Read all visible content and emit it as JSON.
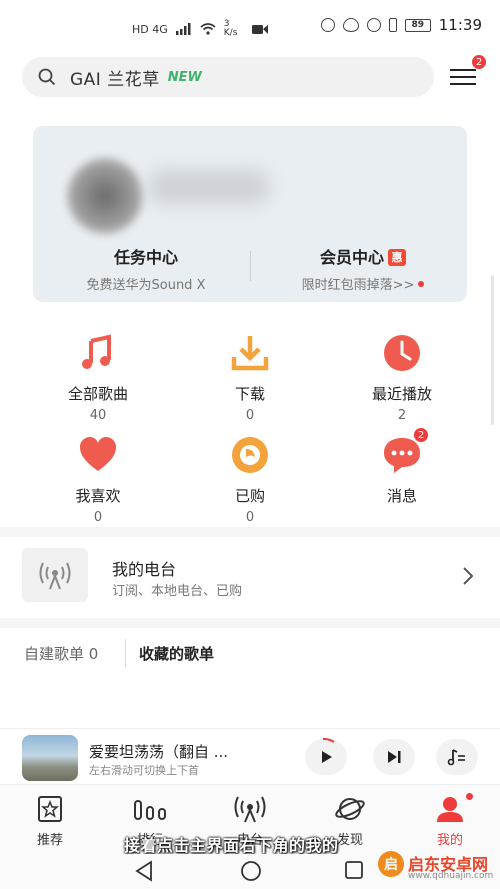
{
  "status_bar": {
    "left_text": "HD 4G",
    "net_speed": "3 K/s",
    "battery": "89",
    "time": "11:39"
  },
  "search": {
    "query": "GAI 兰花草",
    "tag": "NEW",
    "menu_badge": "2"
  },
  "profile_card": {
    "task_center": {
      "title": "任务中心",
      "subtitle": "免费送华为Sound X"
    },
    "vip_center": {
      "title": "会员中心",
      "badge": "惠",
      "subtitle": "限时红包雨掉落>>"
    }
  },
  "grid": [
    {
      "label": "全部歌曲",
      "count": "40",
      "icon": "music-note-icon",
      "color": "#ef5b4e"
    },
    {
      "label": "下载",
      "count": "0",
      "icon": "download-icon",
      "color": "#f4a23b"
    },
    {
      "label": "最近播放",
      "count": "2",
      "icon": "clock-icon",
      "color": "#ef5b4e"
    },
    {
      "label": "我喜欢",
      "count": "0",
      "icon": "heart-icon",
      "color": "#ef5b4e"
    },
    {
      "label": "已购",
      "count": "0",
      "icon": "purchased-disc-icon",
      "color": "#f4a23b"
    },
    {
      "label": "消息",
      "count": "",
      "icon": "message-bubble-icon",
      "color": "#ef5b4e",
      "badge": "2"
    }
  ],
  "radio": {
    "title": "我的电台",
    "subtitle": "订阅、本地电台、已购"
  },
  "playlists": {
    "tab_created": "自建歌单 0",
    "tab_collected": "收藏的歌单"
  },
  "player": {
    "song": "爱要坦荡荡（翻自 ...",
    "hint": "左右滑动可切换上下首"
  },
  "tabs": [
    {
      "label": "推荐",
      "icon": "star-frame-icon"
    },
    {
      "label": "排行",
      "icon": "bars-icon"
    },
    {
      "label": "电台",
      "icon": "radio-icon"
    },
    {
      "label": "发现",
      "icon": "planet-icon"
    },
    {
      "label": "我的",
      "icon": "person-icon",
      "active": true
    }
  ],
  "subtitle_overlay": "接着点击主界面右下角的我的",
  "watermark": {
    "logo": "启",
    "name": "启东安卓网",
    "url": "www.qdhuajin.com"
  },
  "colors": {
    "accent_red": "#ef3b3b",
    "accent_orange": "#f4a23b",
    "new_green": "#3fb36b"
  }
}
